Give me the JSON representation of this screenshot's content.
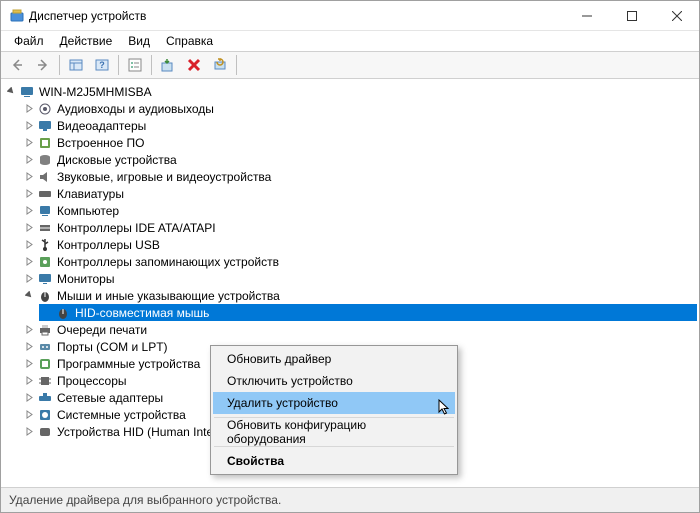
{
  "window": {
    "title": "Диспетчер устройств"
  },
  "menubar": {
    "file": "Файл",
    "action": "Действие",
    "view": "Вид",
    "help": "Справка"
  },
  "tree": {
    "root": "WIN-M2J5MHMISBA",
    "categories": [
      {
        "label": "Аудиовходы и аудиовыходы",
        "expanded": false
      },
      {
        "label": "Видеоадаптеры",
        "expanded": false
      },
      {
        "label": "Встроенное ПО",
        "expanded": false
      },
      {
        "label": "Дисковые устройства",
        "expanded": false
      },
      {
        "label": "Звуковые, игровые и видеоустройства",
        "expanded": false
      },
      {
        "label": "Клавиатуры",
        "expanded": false
      },
      {
        "label": "Компьютер",
        "expanded": false
      },
      {
        "label": "Контроллеры IDE ATA/ATAPI",
        "expanded": false
      },
      {
        "label": "Контроллеры USB",
        "expanded": false
      },
      {
        "label": "Контроллеры запоминающих устройств",
        "expanded": false
      },
      {
        "label": "Мониторы",
        "expanded": false
      },
      {
        "label": "Мыши и иные указывающие устройства",
        "expanded": true,
        "children": [
          {
            "label": "HID-совместимая мышь",
            "selected": true
          }
        ]
      },
      {
        "label": "Очереди печати",
        "expanded": false
      },
      {
        "label": "Порты (COM и LPT)",
        "expanded": false
      },
      {
        "label": "Программные устройства",
        "expanded": false
      },
      {
        "label": "Процессоры",
        "expanded": false
      },
      {
        "label": "Сетевые адаптеры",
        "expanded": false
      },
      {
        "label": "Системные устройства",
        "expanded": false
      },
      {
        "label": "Устройства HID (Human Interface Devices)",
        "expanded": false
      }
    ]
  },
  "context_menu": {
    "items": [
      {
        "label": "Обновить драйвер",
        "highlight": false
      },
      {
        "label": "Отключить устройство",
        "highlight": false
      },
      {
        "label": "Удалить устройство",
        "highlight": true
      },
      {
        "sep": true
      },
      {
        "label": "Обновить конфигурацию оборудования",
        "highlight": false
      },
      {
        "sep": true
      },
      {
        "label": "Свойства",
        "highlight": false,
        "bold": true
      }
    ]
  },
  "statusbar": {
    "text": "Удаление драйвера для выбранного устройства."
  },
  "icons": {
    "audio": "#5a5a6a",
    "display": "#3a7aa8",
    "firmware": "#6aa04a",
    "disk": "#808080",
    "sound": "#707070",
    "keyboard": "#666",
    "computer": "#3a7aa8",
    "ide": "#666",
    "usb": "#333",
    "storage": "#5aa05a",
    "monitor": "#3a7aa8",
    "mouse": "#444",
    "printer": "#666",
    "port": "#5a8aa8",
    "soft": "#5aa05a",
    "cpu": "#666",
    "network": "#3a7aa8",
    "system": "#3a7aa8",
    "hid": "#666"
  }
}
